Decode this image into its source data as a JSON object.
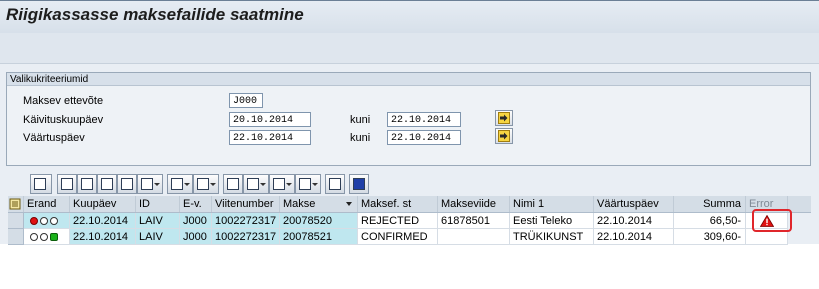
{
  "window": {
    "title": "Riigikassasse maksefailide saatmine"
  },
  "criteria": {
    "title": "Valikukriteeriumid",
    "rows": [
      {
        "label": "Maksev ettevõte",
        "value": "J000"
      },
      {
        "label": "Käivituskuupäev",
        "value": "20.10.2014",
        "to_label": "kuni",
        "to_value": "22.10.2014"
      },
      {
        "label": "Väärtuspäev",
        "value": "22.10.2014",
        "to_label": "kuni",
        "to_value": "22.10.2014"
      }
    ]
  },
  "toolbar": {
    "buttons": [
      "details-icon",
      "print-icon",
      "filter-icon",
      "find-icon",
      "find-next-icon",
      "set-filter-icon",
      "sum-icon",
      "subtotal-icon",
      "print-preview-icon",
      "export-icon",
      "spreadsheet-icon",
      "layout-icon",
      "column-icon",
      "info-icon"
    ]
  },
  "grid": {
    "columns": [
      "Erand",
      "Kuupäev",
      "ID",
      "E-v.",
      "Viitenumber",
      "Makse",
      "Maksef. st",
      "Makseviide",
      "Nimi 1",
      "Väärtuspäev",
      "Summa",
      "Error"
    ],
    "rows": [
      {
        "status": "red",
        "date": "22.10.2014",
        "id": "LAIV",
        "company": "J000",
        "reference": "1002272317",
        "payment": "20078520",
        "state": "REJECTED",
        "payment_ref": "61878501",
        "name": "Eesti Teleko",
        "value_date": "22.10.2014",
        "amount": "66,50-",
        "error": "warning-icon"
      },
      {
        "status": "green",
        "date": "22.10.2014",
        "id": "LAIV",
        "company": "J000",
        "reference": "1002272317",
        "payment": "20078521",
        "state": "CONFIRMED",
        "payment_ref": "",
        "name": "TRÜKIKUNST",
        "value_date": "22.10.2014",
        "amount": "309,60-",
        "error": ""
      }
    ]
  },
  "colors": {
    "key_column": "#bfe7ef",
    "highlight": "#e0262b"
  }
}
